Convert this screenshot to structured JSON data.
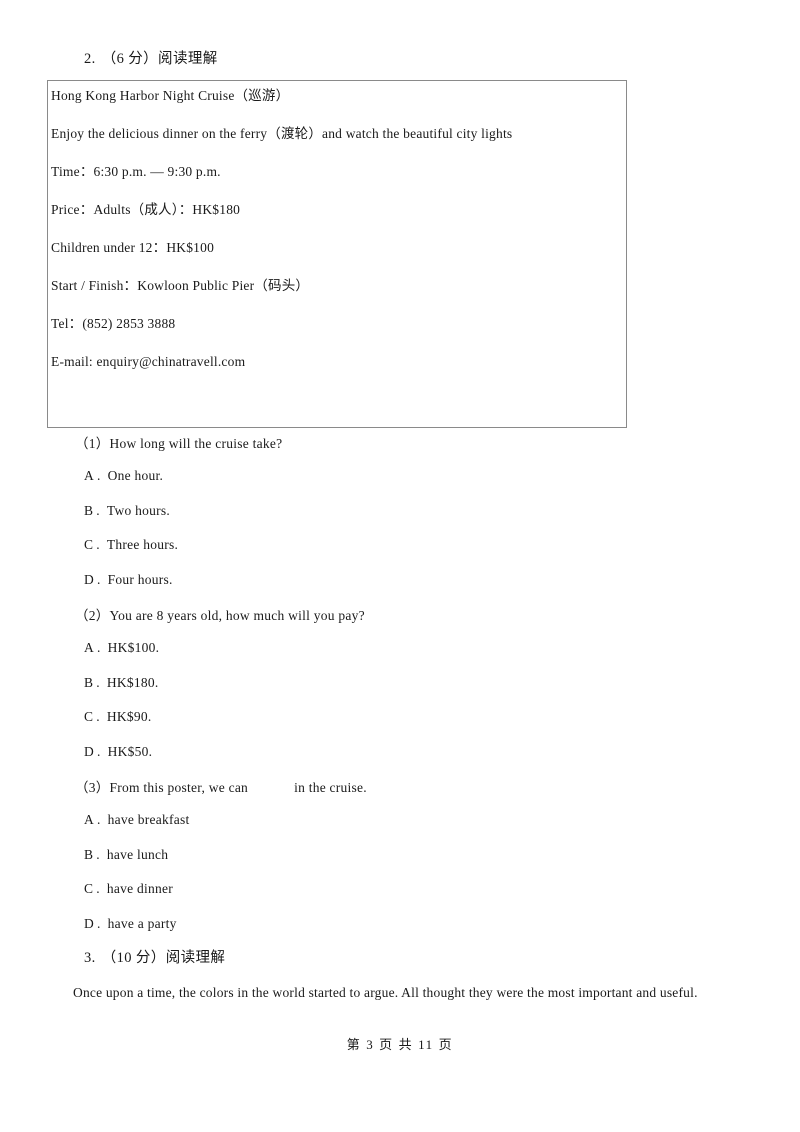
{
  "page": {
    "background": "#ffffff",
    "text_color": "#1a1a1a",
    "border_color": "#8a8a8a"
  },
  "exercise2": {
    "number": "2.",
    "label": "（6 分）阅读理解"
  },
  "poster": {
    "title": "Hong Kong Harbor Night Cruise（巡游）",
    "description": "Enjoy the delicious dinner on the ferry（渡轮）and watch the beautiful city lights",
    "time": "Time：6:30 p.m. — 9:30 p.m.",
    "price_adults": "Price：Adults（成人）：HK$180",
    "price_children": "Children under 12：HK$100",
    "start_finish": "Start / Finish：Kowloon Public Pier（码头）",
    "tel": "Tel：(852) 2853 3888",
    "email": "E-mail: enquiry@chinatravell.com"
  },
  "questions": [
    {
      "prompt_before": "（1）How long will the cruise take?",
      "prompt_after": "",
      "has_gap": false,
      "options": [
        {
          "letter": "A",
          "dot": ".",
          "text": "One hour."
        },
        {
          "letter": "B",
          "dot": ".",
          "text": "Two hours."
        },
        {
          "letter": "C",
          "dot": ".",
          "text": "Three hours."
        },
        {
          "letter": "D",
          "dot": ".",
          "text": "Four hours."
        }
      ]
    },
    {
      "prompt_before": "（2）You are 8 years old, how much will you pay?",
      "prompt_after": "",
      "has_gap": false,
      "options": [
        {
          "letter": "A",
          "dot": ".",
          "text": "HK$100."
        },
        {
          "letter": "B",
          "dot": ".",
          "text": "HK$180."
        },
        {
          "letter": "C",
          "dot": ".",
          "text": "HK$90."
        },
        {
          "letter": "D",
          "dot": ".",
          "text": "HK$50."
        }
      ]
    },
    {
      "prompt_before": "（3）From this poster, we can",
      "prompt_after": "in the cruise.",
      "has_gap": true,
      "options": [
        {
          "letter": "A",
          "dot": ".",
          "text": "have breakfast"
        },
        {
          "letter": "B",
          "dot": ".",
          "text": "have lunch"
        },
        {
          "letter": "C",
          "dot": ".",
          "text": "have dinner"
        },
        {
          "letter": "D",
          "dot": ".",
          "text": "have a party"
        }
      ]
    }
  ],
  "exercise3": {
    "number": "3.",
    "label": "（10 分）阅读理解",
    "passage": "Once upon a time, the colors in the world started to argue. All thought they were the most important and useful."
  },
  "footer": {
    "text": "第 3 页 共 11 页",
    "current_page": "3",
    "total_pages": "11"
  }
}
